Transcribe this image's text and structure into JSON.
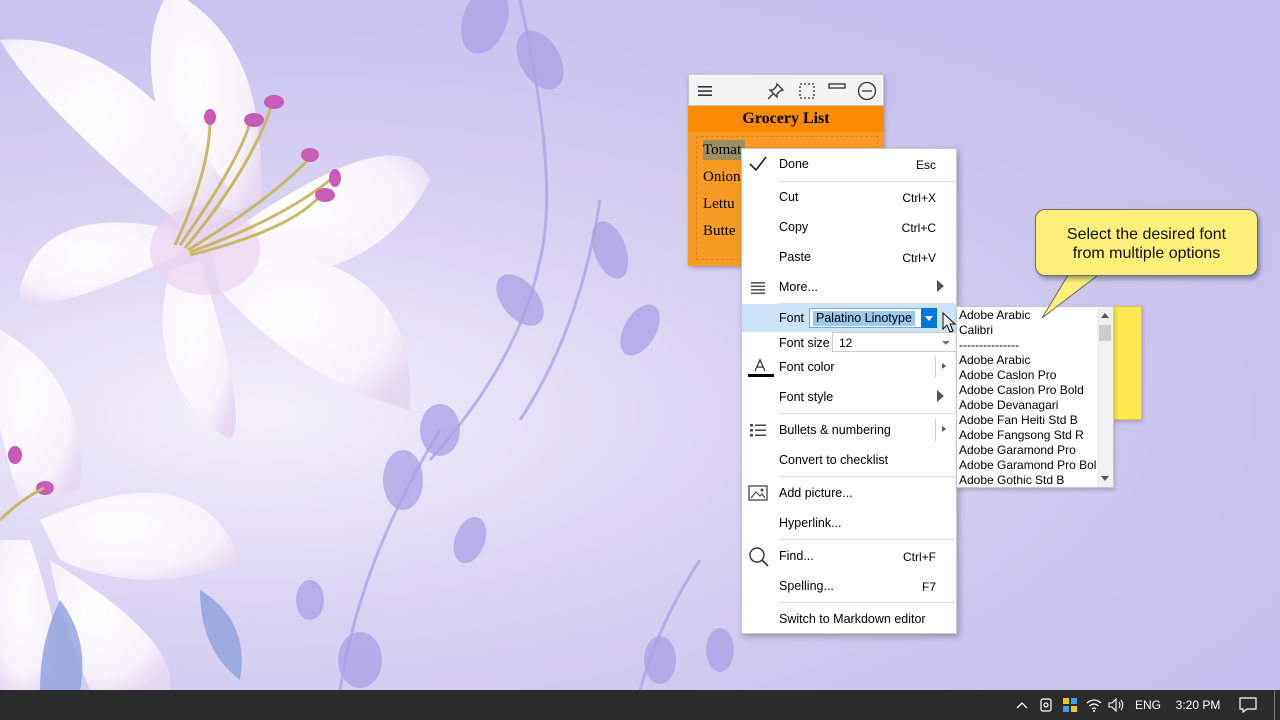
{
  "note": {
    "title": "Grocery List",
    "lines": [
      "Tomat",
      "Onion",
      "Lettu",
      "Butte"
    ],
    "toolbar_icons": [
      "menu-icon",
      "pin-icon",
      "select-icon",
      "collapse-icon",
      "minimize-icon"
    ],
    "color": "#f79b25",
    "title_color": "#fb8c00"
  },
  "menu": {
    "done": {
      "label": "Done",
      "shortcut": "Esc"
    },
    "cut": {
      "label": "Cut",
      "shortcut": "Ctrl+X"
    },
    "copy": {
      "label": "Copy",
      "shortcut": "Ctrl+C"
    },
    "paste": {
      "label": "Paste",
      "shortcut": "Ctrl+V"
    },
    "more": {
      "label": "More..."
    },
    "font": {
      "label": "Font",
      "value": "Palatino Linotype"
    },
    "font_size": {
      "label": "Font size",
      "value": "12"
    },
    "font_color": {
      "label": "Font color"
    },
    "font_style": {
      "label": "Font style"
    },
    "bullets": {
      "label": "Bullets & numbering"
    },
    "checklist": {
      "label": "Convert to checklist"
    },
    "picture": {
      "label": "Add picture..."
    },
    "hyperlink": {
      "label": "Hyperlink..."
    },
    "find": {
      "label": "Find...",
      "shortcut": "Ctrl+F"
    },
    "spelling": {
      "label": "Spelling...",
      "shortcut": "F7"
    },
    "markdown": {
      "label": "Switch to Markdown editor"
    }
  },
  "font_list": {
    "items": [
      "Adobe Arabic",
      "Calibri",
      "---------------",
      "Adobe Arabic",
      "Adobe Caslon Pro",
      "Adobe Caslon Pro Bold",
      "Adobe Devanagari",
      "Adobe Fan Heiti Std B",
      "Adobe Fangsong Std R",
      "Adobe Garamond Pro",
      "Adobe Garamond Pro Bold",
      "Adobe Gothic Std B"
    ]
  },
  "callout": {
    "line1": "Select the desired font",
    "line2": "from multiple options",
    "color": "#fdf07a"
  },
  "taskbar": {
    "language": "ENG",
    "time": "3:20 PM"
  }
}
